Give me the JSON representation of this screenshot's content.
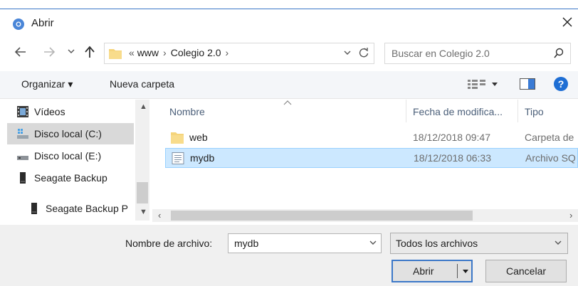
{
  "window": {
    "title": "Abrir",
    "accent_color": "#3c78c8",
    "app_icon": "chrome-icon",
    "close_icon": "close-icon"
  },
  "navigation": {
    "back_icon": "back-arrow-icon",
    "forward_icon": "forward-arrow-icon",
    "recent_icon": "chevron-down-icon",
    "up_icon": "up-arrow-icon",
    "address": {
      "prefix": "«",
      "segments": [
        "www",
        "Colegio 2.0"
      ],
      "refresh_icon": "refresh-icon"
    },
    "search_placeholder": "Buscar en Colegio 2.0"
  },
  "toolbar": {
    "organize_label": "Organizar ▾",
    "new_folder_label": "Nueva carpeta",
    "help_label": "?"
  },
  "nav_pane": {
    "items": [
      {
        "label": "Vídeos",
        "icon": "video-icon",
        "selected": false
      },
      {
        "label": "Disco local (C:)",
        "icon": "windows-drive-icon",
        "selected": true
      },
      {
        "label": "Disco local (E:)",
        "icon": "drive-icon",
        "selected": false
      },
      {
        "label": "Seagate Backup",
        "icon": "external-drive-icon",
        "selected": false
      },
      {
        "label": "Seagate Backup P",
        "icon": "external-drive-icon",
        "selected": false
      }
    ]
  },
  "file_list": {
    "columns": [
      "Nombre",
      "Fecha de modifica...",
      "Tipo"
    ],
    "rows": [
      {
        "name": "web",
        "date": "18/12/2018 09:47",
        "type": "Carpeta de",
        "icon": "folder-icon",
        "selected": false
      },
      {
        "name": "mydb",
        "date": "18/12/2018 06:33",
        "type": "Archivo SQ",
        "icon": "file-icon",
        "selected": true
      }
    ]
  },
  "bottom": {
    "filename_label": "Nombre de archivo:",
    "filename_value": "mydb",
    "filetype_value": "Todos los archivos",
    "open_label": "Abrir",
    "cancel_label": "Cancelar"
  }
}
